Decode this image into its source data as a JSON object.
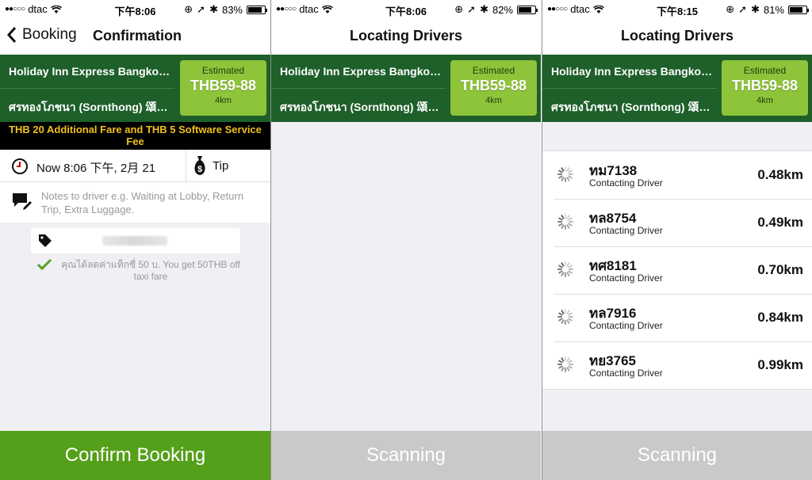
{
  "screens": [
    {
      "status": {
        "carrier": "dtac",
        "time": "下午8:06",
        "battery": "83%",
        "battery_level": 0.83
      },
      "nav": {
        "back_label": "Booking",
        "title": "Confirmation"
      },
      "route": {
        "from": "Holiday Inn Express Bangkok Sukhumvit",
        "to": "ศรทองโภชนา (Sornthong) 頌通海鮮餐廳"
      },
      "estimate": {
        "label": "Estimated",
        "price": "THB59-88",
        "distance": "4km"
      },
      "fare_notice": "THB 20 Additional Fare and THB 5 Software Service Fee",
      "pickup_time": "Now 8:06 下午, 2月 21",
      "tip_label": "Tip",
      "notes_placeholder": "Notes to driver e.g. Waiting at Lobby, Return Trip, Extra Luggage.",
      "promo_message": "คุณได้ลดค่าแท็กซี่ 50 บ. You get 50THB off taxi fare",
      "button": "Confirm Booking"
    },
    {
      "status": {
        "carrier": "dtac",
        "time": "下午8:06",
        "battery": "82%",
        "battery_level": 0.82
      },
      "nav": {
        "title": "Locating Drivers"
      },
      "route": {
        "from": "Holiday Inn Express Bangkok Sukhumvit",
        "to": "ศรทองโภชนา (Sornthong) 頌通海鮮餐廳"
      },
      "estimate": {
        "label": "Estimated",
        "price": "THB59-88",
        "distance": "4km"
      },
      "button": "Scanning"
    },
    {
      "status": {
        "carrier": "dtac",
        "time": "下午8:15",
        "battery": "81%",
        "battery_level": 0.81
      },
      "nav": {
        "title": "Locating Drivers"
      },
      "route": {
        "from": "Holiday Inn Express Bangkok Sukhumvit",
        "to": "ศรทองโภชนา (Sornthong) 頌通海鮮餐廳"
      },
      "estimate": {
        "label": "Estimated",
        "price": "THB59-88",
        "distance": "4km"
      },
      "drivers": [
        {
          "plate": "ทม7138",
          "status": "Contacting Driver",
          "distance": "0.48km"
        },
        {
          "plate": "ทล8754",
          "status": "Contacting Driver",
          "distance": "0.49km"
        },
        {
          "plate": "ทศ8181",
          "status": "Contacting Driver",
          "distance": "0.70km"
        },
        {
          "plate": "ทล7916",
          "status": "Contacting Driver",
          "distance": "0.84km"
        },
        {
          "plate": "ทย3765",
          "status": "Contacting Driver",
          "distance": "0.99km"
        }
      ],
      "button": "Scanning"
    }
  ],
  "colors": {
    "route_bg": "#1e5f2a",
    "estimate_bg": "#8ec43a",
    "confirm_bg": "#55a01a",
    "scanning_bg": "#c9c9c9",
    "notice_text": "#f0c21b"
  }
}
